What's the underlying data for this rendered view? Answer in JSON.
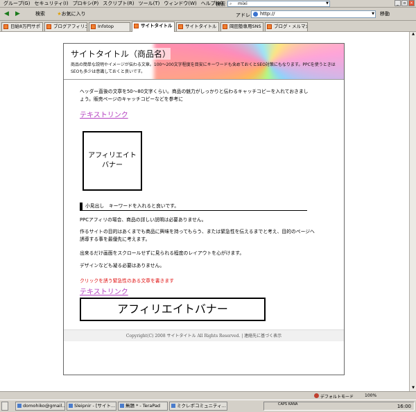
{
  "menubar": {
    "items": [
      "グループ(G)",
      "セキュリティ(I)",
      "プロキシ(P)",
      "スクリプト(R)",
      "ツール(T)",
      "ウィンドウ(W)",
      "ヘルプ(H)"
    ],
    "search_label": "検索",
    "search_value": "mixi"
  },
  "toolbar": {
    "search_label": "検索",
    "favorites_label": "お気に入り",
    "address_label": "アドレス",
    "address_value": "http://",
    "go_label": "移動"
  },
  "tabs": [
    {
      "label": "日給8万円サポ"
    },
    {
      "label": "ブログアフィリエイ"
    },
    {
      "label": "Infotop"
    },
    {
      "label": "サイトタイトル"
    },
    {
      "label": "サイトタイトル"
    },
    {
      "label": "岡田塾専用SNS"
    },
    {
      "label": "ブログ・メルマガ"
    }
  ],
  "page": {
    "title": "サイトタイトル（商品名）",
    "header_desc": "商品の簡単な説明やイメージが伝わる文章。100〜200文字程度を目安にキーワードも含めておくとSEO対策にもなります。PPCを使うときはSEOも多少は意識しておくと良いです。",
    "lead": "ヘッダー直後の文章を50〜80文字くらい。商品の魅力がしっかりと伝わるキャッチコピーを入れておきましょう。販売ページのキャッチコピーなどを参考に",
    "text_link_1": "テキストリンク",
    "banner_square_line1": "アフィリエイト",
    "banner_square_line2": "バナー",
    "subhead": "小見出し　キーワードを入れると良いです。",
    "p1": "PPCアフィリの場合、商品の詳しい説明は必要ありません。",
    "p2": "作るサイトの目的はあくまでも商品に興味を持ってもらう、または緊急性を伝えるまでと考え、目的のページへ誘導する事を最優先に考えます。",
    "p3": "出来るだけ画面をスクロールせずに見られる程度のレイアウトを心がけます。",
    "p4": "デザインなども凝る必要はありません。",
    "urgent": "クリックを誘う緊急性のある文章を書きます",
    "text_link_2": "テキストリンク",
    "banner_wide": "アフィリエイトバナー",
    "footer": "Copyright(C) 2008 サイトタイトル All Rights Reserved.  |  連絡先に基づく表示"
  },
  "statusbar": {
    "mode": "デフォルトモード",
    "zoom": "100%"
  },
  "taskbar": {
    "tasks": [
      {
        "label": "domohiko@gmail..."
      },
      {
        "label": "Sleipnir - [サイト..."
      },
      {
        "label": "無題 * - TeraPad"
      },
      {
        "label": "ミクレポコミュニティ..."
      }
    ],
    "ime": "CAPS KANA",
    "clock": "16:00"
  },
  "colors": {
    "link": "#b440c0",
    "urgent": "#e01010"
  }
}
